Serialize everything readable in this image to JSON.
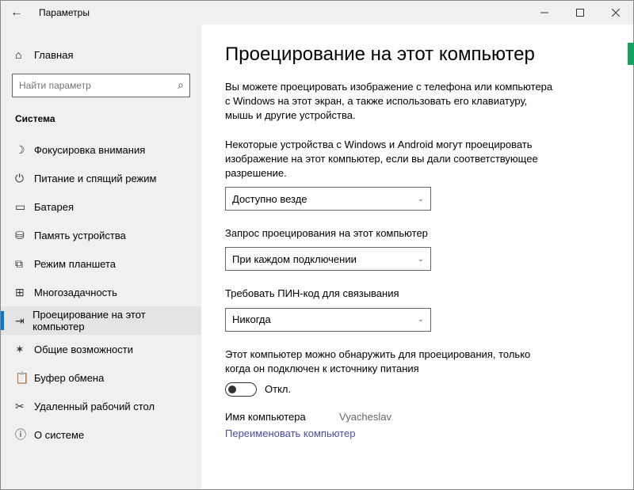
{
  "window": {
    "title": "Параметры"
  },
  "sidebar": {
    "home": "Главная",
    "search_placeholder": "Найти параметр",
    "section": "Система",
    "items": [
      {
        "icon": "focus-assist-icon",
        "glyph": "☽",
        "label": "Фокусировка внимания"
      },
      {
        "icon": "power-icon",
        "glyph": "⏻",
        "label": "Питание и спящий режим"
      },
      {
        "icon": "battery-icon",
        "glyph": "▭",
        "label": "Батарея"
      },
      {
        "icon": "storage-icon",
        "glyph": "⛁",
        "label": "Память устройства"
      },
      {
        "icon": "tablet-icon",
        "glyph": "⧉",
        "label": "Режим планшета"
      },
      {
        "icon": "multitask-icon",
        "glyph": "⊞",
        "label": "Многозадачность"
      },
      {
        "icon": "projecting-icon",
        "glyph": "⇥",
        "label": "Проецирование на этот компьютер"
      },
      {
        "icon": "shared-icon",
        "glyph": "✶",
        "label": "Общие возможности"
      },
      {
        "icon": "clipboard-icon",
        "glyph": "📋",
        "label": "Буфер обмена"
      },
      {
        "icon": "remote-icon",
        "glyph": "✂",
        "label": "Удаленный рабочий стол"
      },
      {
        "icon": "about-icon",
        "glyph": "ⓘ",
        "label": "О системе"
      }
    ],
    "active_index": 6
  },
  "main": {
    "heading": "Проецирование на этот компьютер",
    "description": "Вы можете проецировать изображение с телефона или компьютера с Windows на этот экран, а также использовать его клавиатуру, мышь и другие устройства.",
    "section1_label": "Некоторые устройства с Windows и Android могут проецировать изображение на этот компьютер, если вы дали соответствующее разрешение.",
    "combo1": "Доступно везде",
    "section2_label": "Запрос проецирования на этот компьютер",
    "combo2": "При каждом подключении",
    "section3_label": "Требовать ПИН-код для связывания",
    "combo3": "Никогда",
    "power_label": "Этот компьютер можно обнаружить для проецирования, только когда он подключен к источнику питания",
    "toggle_state": "Откл.",
    "pcname_label": "Имя компьютера",
    "pcname_value": "Vyacheslav",
    "rename_link": "Переименовать компьютер"
  }
}
